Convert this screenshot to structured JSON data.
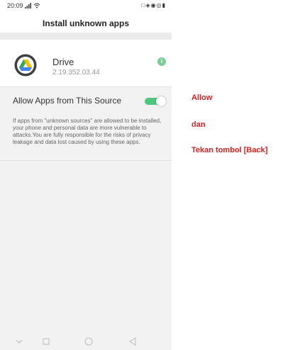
{
  "status_bar": {
    "time": "20:09",
    "indicators_right": "□◈◉◎▮"
  },
  "header": {
    "title": "Install unknown apps"
  },
  "app": {
    "name": "Drive",
    "version": "2.19.352.03.44",
    "info_icon_glyph": "i"
  },
  "permission": {
    "label": "Allow Apps from This Source",
    "enabled": true,
    "description": "If apps from \"unknown sources\" are allowed to be installed, your phone and personal data are more vulnerable to attacks.You are fully responsible for the risks of privacy leakage and data lost caused by using these apps."
  },
  "annotations": {
    "step1": "Allow",
    "step2": "dan",
    "step3": "Tekan tombol [Back]"
  },
  "colors": {
    "toggle_on": "#4cc77b",
    "annotation": "#d32020",
    "info_badge": "#7ccc9a"
  }
}
